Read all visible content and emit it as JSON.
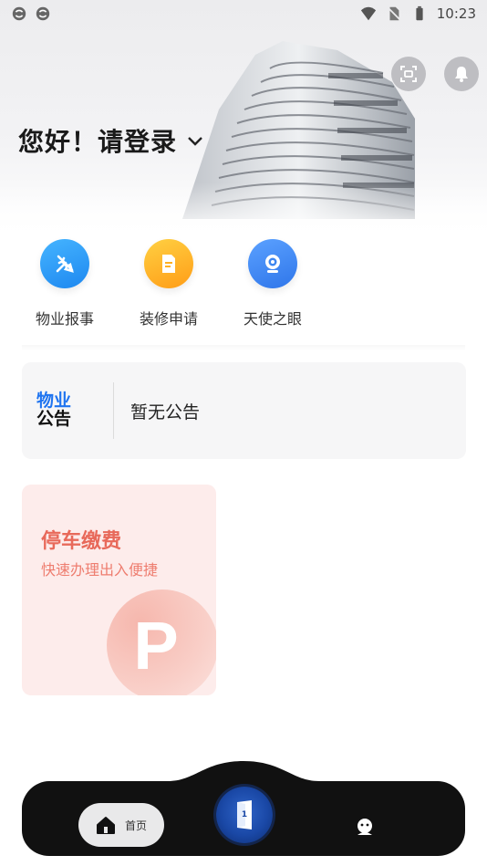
{
  "status_bar": {
    "time": "10:23",
    "left_icons": [
      "sync-icon",
      "sync-icon"
    ],
    "right_icons": [
      "wifi-icon",
      "no-sim-icon",
      "battery-icon"
    ]
  },
  "header": {
    "greeting": "您好！请登录",
    "scan_icon": "scan-icon",
    "bell_icon": "bell-icon"
  },
  "quick_actions": [
    {
      "label": "物业报事",
      "icon": "tools-icon",
      "color": "#2f9bf5"
    },
    {
      "label": "装修申请",
      "icon": "document-icon",
      "color": "#ffb020"
    },
    {
      "label": "天使之眼",
      "icon": "camera-icon",
      "color": "#3d86f0"
    }
  ],
  "notice": {
    "logo_line1": "物业",
    "logo_line2": "公告",
    "text": "暂无公告"
  },
  "parking": {
    "title": "停车缴费",
    "subtitle": "快速办理出入便捷",
    "badge": "P"
  },
  "bottom_nav": {
    "home_label": "首页",
    "center_badge": "1",
    "items": [
      "home-icon",
      "door-icon",
      "profile-icon"
    ]
  },
  "colors": {
    "accent_blue": "#1f74f0",
    "parking_red": "#e8695a",
    "nav_bg": "#111111"
  }
}
